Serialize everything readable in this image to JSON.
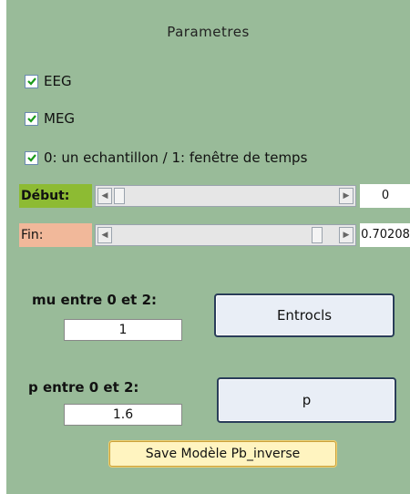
{
  "panel": {
    "title": "Parametres",
    "background": "#99bb99"
  },
  "checkboxes": [
    {
      "label": "EEG",
      "checked": true
    },
    {
      "label": "MEG",
      "checked": true
    },
    {
      "label": "0: un echantillon / 1: fenêtre de temps",
      "checked": true
    }
  ],
  "sliders": {
    "debut": {
      "label": "Début:",
      "value_text": "0",
      "value": 0.0
    },
    "fin": {
      "label": "Fin:",
      "value_text": "0.70208",
      "value": 0.93
    }
  },
  "mu": {
    "label": "mu entre 0 et 2:",
    "value": "1",
    "button_label": "Entrocls"
  },
  "p": {
    "label": "p entre 0 et 2:",
    "value": "1.6",
    "button_label": "p"
  },
  "save_button_label": "Save Modèle Pb_inverse",
  "colors": {
    "debut_label_bg": "#8dbb33",
    "fin_label_bg": "#f1b89a",
    "save_button_bg": "#fff4c0"
  }
}
